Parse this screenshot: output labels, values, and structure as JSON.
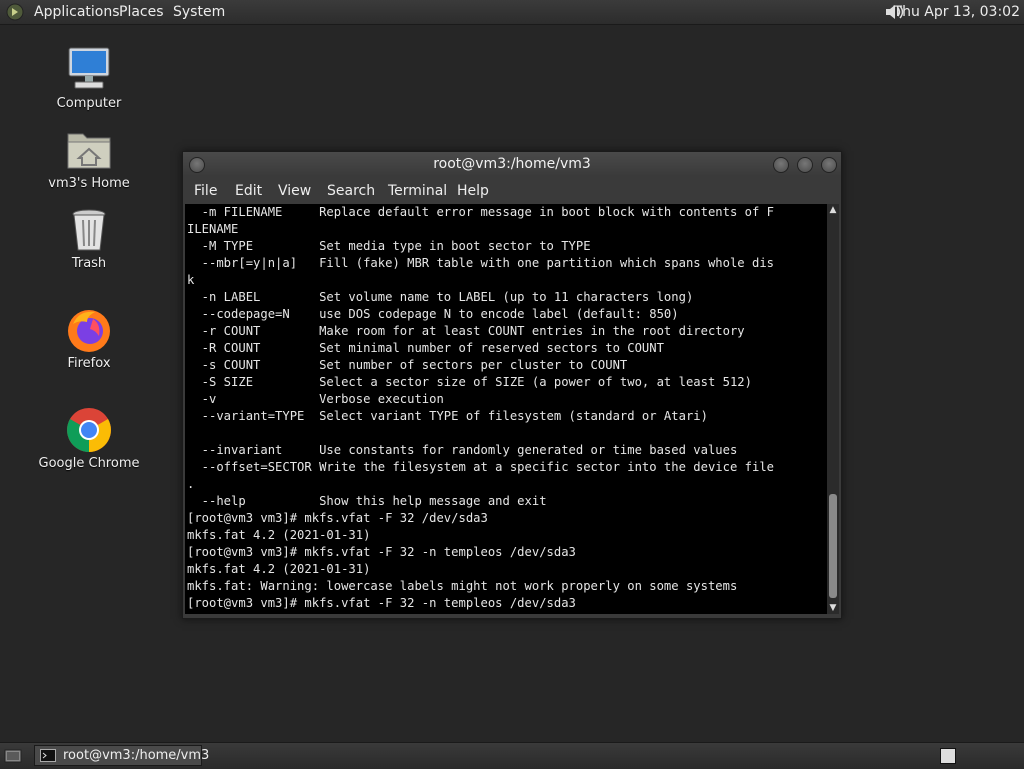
{
  "top_panel": {
    "menus": [
      "Applications",
      "Places",
      "System"
    ],
    "clock": "Thu Apr 13, 03:02",
    "logo_icon": "gnome-foot-icon",
    "volume_icon": "speaker-icon"
  },
  "desktop": {
    "icons": [
      {
        "label": "Computer",
        "icon": "computer-icon"
      },
      {
        "label": "vm3's Home",
        "icon": "home-folder-icon"
      },
      {
        "label": "Trash",
        "icon": "trash-icon"
      },
      {
        "label": "Firefox",
        "icon": "firefox-icon"
      },
      {
        "label": "Google Chrome",
        "icon": "chrome-icon"
      }
    ]
  },
  "terminal": {
    "title": "root@vm3:/home/vm3",
    "menus": [
      "File",
      "Edit",
      "View",
      "Search",
      "Terminal",
      "Help"
    ],
    "lines": [
      "  -m FILENAME     Replace default error message in boot block with contents of F",
      "ILENAME",
      "  -M TYPE         Set media type in boot sector to TYPE",
      "  --mbr[=y|n|a]   Fill (fake) MBR table with one partition which spans whole dis",
      "k",
      "  -n LABEL        Set volume name to LABEL (up to 11 characters long)",
      "  --codepage=N    use DOS codepage N to encode label (default: 850)",
      "  -r COUNT        Make room for at least COUNT entries in the root directory",
      "  -R COUNT        Set minimal number of reserved sectors to COUNT",
      "  -s COUNT        Set number of sectors per cluster to COUNT",
      "  -S SIZE         Select a sector size of SIZE (a power of two, at least 512)",
      "  -v              Verbose execution",
      "  --variant=TYPE  Select variant TYPE of filesystem (standard or Atari)",
      "",
      "  --invariant     Use constants for randomly generated or time based values",
      "  --offset=SECTOR Write the filesystem at a specific sector into the device file",
      ".",
      "  --help          Show this help message and exit",
      "[root@vm3 vm3]# mkfs.vfat -F 32 /dev/sda3",
      "mkfs.fat 4.2 (2021-01-31)",
      "[root@vm3 vm3]# mkfs.vfat -F 32 -n templeos /dev/sda3",
      "mkfs.fat 4.2 (2021-01-31)",
      "mkfs.fat: Warning: lowercase labels might not work properly on some systems",
      "[root@vm3 vm3]# mkfs.vfat -F 32 -n templeos /dev/sda3"
    ]
  },
  "taskbar": {
    "items": [
      {
        "label": "root@vm3:/home/vm3",
        "icon": "terminal-icon"
      }
    ]
  }
}
